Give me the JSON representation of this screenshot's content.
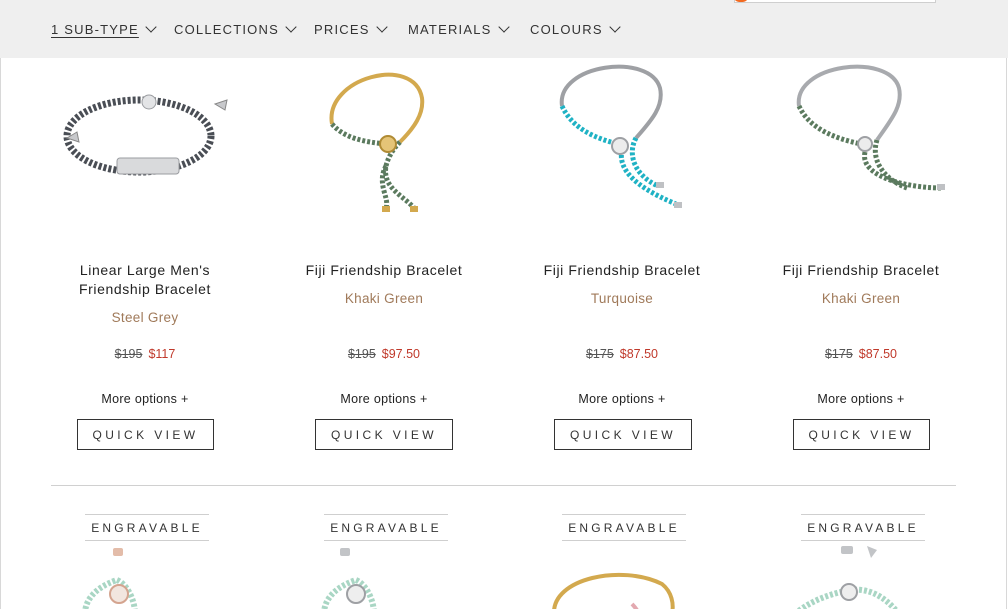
{
  "filters": [
    {
      "label": "1 SUB-TYPE",
      "active": true
    },
    {
      "label": "COLLECTIONS",
      "active": false
    },
    {
      "label": "PRICES",
      "active": false
    },
    {
      "label": "MATERIALS",
      "active": false
    },
    {
      "label": "COLOURS",
      "active": false
    }
  ],
  "products": [
    {
      "name": "Linear Large Men's Friendship Bracelet",
      "color": "Steel Grey",
      "was": "$195",
      "now": "$117",
      "more": "More options +",
      "quick_view": "QUICK VIEW",
      "cord_color": "#4a4e55",
      "metal": "silver"
    },
    {
      "name": "Fiji Friendship Bracelet",
      "color": "Khaki Green",
      "was": "$195",
      "now": "$97.50",
      "more": "More options +",
      "quick_view": "QUICK VIEW",
      "cord_color": "#5b7a5e",
      "metal": "gold"
    },
    {
      "name": "Fiji Friendship Bracelet",
      "color": "Turquoise",
      "was": "$175",
      "now": "$87.50",
      "more": "More options +",
      "quick_view": "QUICK VIEW",
      "cord_color": "#1fb2c4",
      "metal": "silver"
    },
    {
      "name": "Fiji Friendship Bracelet",
      "color": "Khaki Green",
      "was": "$175",
      "now": "$87.50",
      "more": "More options +",
      "quick_view": "QUICK VIEW",
      "cord_color": "#5b7a5e",
      "metal": "silver"
    }
  ],
  "next_row": [
    {
      "badge": "ENGRAVABLE",
      "cord_color": "#a9d6c4",
      "metal": "rose"
    },
    {
      "badge": "ENGRAVABLE",
      "cord_color": "#a9d6c4",
      "metal": "silver"
    },
    {
      "badge": "ENGRAVABLE",
      "cord_color": "#a9d6c4",
      "metal": "gold"
    },
    {
      "badge": "ENGRAVABLE",
      "cord_color": "#a9d6c4",
      "metal": "silver"
    }
  ],
  "colors": {
    "filter_bg": "#efefef",
    "variant_text": "#a07a5a",
    "sale_price": "#c0392b",
    "search_accent": "#f26a21"
  }
}
